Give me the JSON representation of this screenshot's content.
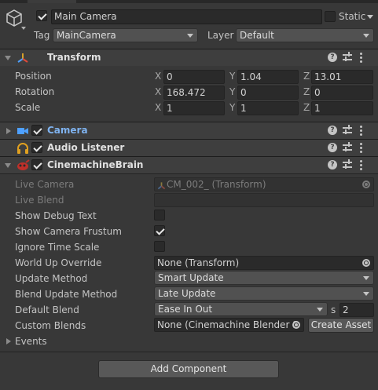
{
  "header": {
    "object_name": "Main Camera",
    "static_label": "Static",
    "tag_label": "Tag",
    "tag_value": "MainCamera",
    "layer_label": "Layer",
    "layer_value": "Default",
    "active_checked": true,
    "static_checked": false
  },
  "transform": {
    "title": "Transform",
    "rows": [
      {
        "label": "Position",
        "x": "0",
        "y": "1.04",
        "z": "13.01"
      },
      {
        "label": "Rotation",
        "x": "168.472",
        "y": "0",
        "z": "0"
      },
      {
        "label": "Scale",
        "x": "1",
        "y": "1",
        "z": "1"
      }
    ],
    "axis_x": "X",
    "axis_y": "Y",
    "axis_z": "Z"
  },
  "camera": {
    "title": "Camera",
    "enabled": true
  },
  "audio_listener": {
    "title": "Audio Listener",
    "enabled": true
  },
  "cinemachine_brain": {
    "title": "CinemachineBrain",
    "enabled": true,
    "live_camera_label": "Live Camera",
    "live_camera_value": "CM_002_ (Transform)",
    "live_blend_label": "Live Blend",
    "show_debug_text_label": "Show Debug Text",
    "show_debug_text": false,
    "show_camera_frustum_label": "Show Camera Frustum",
    "show_camera_frustum": true,
    "ignore_time_scale_label": "Ignore Time Scale",
    "ignore_time_scale": false,
    "world_up_override_label": "World Up Override",
    "world_up_override_value": "None (Transform)",
    "update_method_label": "Update Method",
    "update_method_value": "Smart Update",
    "blend_update_method_label": "Blend Update Method",
    "blend_update_method_value": "Late Update",
    "default_blend_label": "Default Blend",
    "default_blend_value": "Ease In Out",
    "default_blend_s_label": "s",
    "default_blend_seconds": "2",
    "custom_blends_label": "Custom Blends",
    "custom_blends_value": "None (Cinemachine Blender S",
    "create_asset_label": "Create Asset",
    "events_label": "Events"
  },
  "footer": {
    "add_component_label": "Add Component"
  },
  "colors": {
    "background": "#383838",
    "camera_title": "#7fb3f0",
    "field_bg": "#2a2a2a"
  }
}
